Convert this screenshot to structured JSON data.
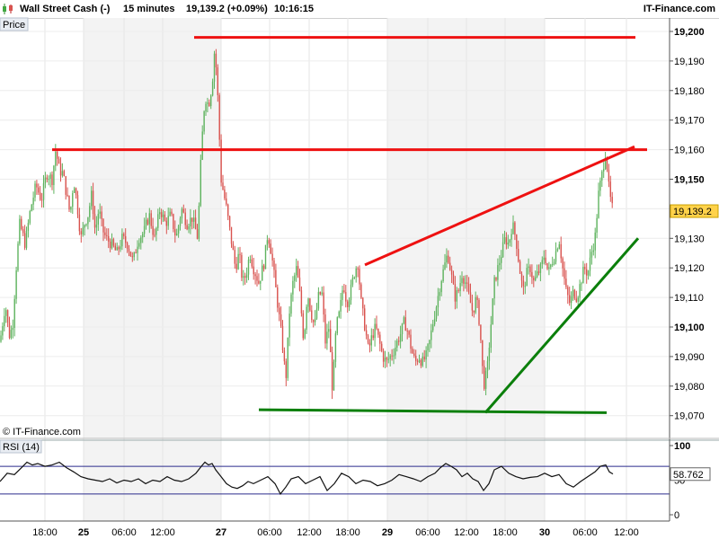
{
  "header": {
    "instrument": "Wall Street Cash (-)",
    "timeframe": "15 minutes",
    "last_price": "19,139.2 (+0.09%)",
    "time": "10:16:15",
    "brand": "IT-Finance.com",
    "chart_icon": "candlestick-icon"
  },
  "panels": {
    "price_label": "Price",
    "copyright": "© IT-Finance.com",
    "rsi_label": "RSI (14)"
  },
  "colors": {
    "bull": "#5fb35f",
    "bear": "#d9534f",
    "resistance": "#ee1111",
    "support": "#0b7f0b",
    "session_shade": "#f3f3f3",
    "rsi_band": "#2b2b8c"
  },
  "chart_data": [
    {
      "type": "candlestick",
      "title": "Wall Street Cash (-)",
      "ylim": [
        19065,
        19205
      ],
      "yticks": [
        19070,
        19080,
        19090,
        19100,
        19110,
        19120,
        19130,
        19140,
        19150,
        19160,
        19170,
        19180,
        19190,
        19200
      ],
      "ytick_labels": [
        "19,070",
        "19,080",
        "19,090",
        "19,100",
        "19,110",
        "19,120",
        "19,130",
        "",
        "19,150",
        "19,160",
        "19,170",
        "19,180",
        "19,190",
        "19,200"
      ],
      "bold_ticks": [
        19100,
        19150,
        19200
      ],
      "last_value": "19,139.2",
      "x_labels": [
        "18:00",
        "25",
        "06:00",
        "12:00",
        "27",
        "06:00",
        "12:00",
        "18:00",
        "29",
        "06:00",
        "12:00",
        "18:00",
        "30",
        "06:00",
        "12:00"
      ],
      "bold_x_labels": [
        "25",
        "27",
        "29",
        "30"
      ],
      "close_path": [
        [
          0,
          19095
        ],
        [
          6,
          19108
        ],
        [
          10,
          19097
        ],
        [
          14,
          19100
        ],
        [
          18,
          19120
        ],
        [
          22,
          19135
        ],
        [
          28,
          19128
        ],
        [
          34,
          19140
        ],
        [
          40,
          19148
        ],
        [
          46,
          19143
        ],
        [
          52,
          19152
        ],
        [
          58,
          19150
        ],
        [
          62,
          19160
        ],
        [
          66,
          19153
        ],
        [
          70,
          19152
        ],
        [
          74,
          19145
        ],
        [
          78,
          19138
        ],
        [
          82,
          19150
        ],
        [
          86,
          19141
        ],
        [
          90,
          19130
        ],
        [
          94,
          19135
        ],
        [
          98,
          19138
        ],
        [
          102,
          19145
        ],
        [
          106,
          19132
        ],
        [
          110,
          19140
        ],
        [
          114,
          19133
        ],
        [
          118,
          19130
        ],
        [
          124,
          19128
        ],
        [
          130,
          19125
        ],
        [
          136,
          19130
        ],
        [
          142,
          19128
        ],
        [
          148,
          19122
        ],
        [
          154,
          19130
        ],
        [
          160,
          19132
        ],
        [
          166,
          19138
        ],
        [
          172,
          19130
        ],
        [
          178,
          19140
        ],
        [
          184,
          19135
        ],
        [
          190,
          19138
        ],
        [
          196,
          19130
        ],
        [
          202,
          19140
        ],
        [
          208,
          19135
        ],
        [
          214,
          19137
        ],
        [
          220,
          19130
        ],
        [
          224,
          19160
        ],
        [
          228,
          19178
        ],
        [
          232,
          19175
        ],
        [
          236,
          19182
        ],
        [
          239,
          19195
        ],
        [
          242,
          19180
        ],
        [
          246,
          19150
        ],
        [
          252,
          19140
        ],
        [
          258,
          19128
        ],
        [
          262,
          19120
        ],
        [
          266,
          19125
        ],
        [
          270,
          19115
        ],
        [
          274,
          19118
        ],
        [
          278,
          19125
        ],
        [
          282,
          19120
        ],
        [
          288,
          19115
        ],
        [
          294,
          19122
        ],
        [
          298,
          19132
        ],
        [
          302,
          19125
        ],
        [
          306,
          19115
        ],
        [
          310,
          19105
        ],
        [
          314,
          19095
        ],
        [
          318,
          19082
        ],
        [
          322,
          19105
        ],
        [
          326,
          19115
        ],
        [
          330,
          19120
        ],
        [
          334,
          19110
        ],
        [
          338,
          19095
        ],
        [
          342,
          19112
        ],
        [
          346,
          19105
        ],
        [
          350,
          19100
        ],
        [
          354,
          19110
        ],
        [
          358,
          19112
        ],
        [
          362,
          19095
        ],
        [
          366,
          19100
        ],
        [
          370,
          19078
        ],
        [
          374,
          19100
        ],
        [
          378,
          19105
        ],
        [
          382,
          19115
        ],
        [
          386,
          19108
        ],
        [
          390,
          19112
        ],
        [
          394,
          19118
        ],
        [
          398,
          19122
        ],
        [
          402,
          19108
        ],
        [
          406,
          19100
        ],
        [
          410,
          19092
        ],
        [
          414,
          19097
        ],
        [
          418,
          19100
        ],
        [
          422,
          19095
        ],
        [
          426,
          19090
        ],
        [
          430,
          19088
        ],
        [
          434,
          19090
        ],
        [
          438,
          19092
        ],
        [
          442,
          19095
        ],
        [
          446,
          19098
        ],
        [
          450,
          19102
        ],
        [
          454,
          19098
        ],
        [
          458,
          19092
        ],
        [
          462,
          19088
        ],
        [
          466,
          19090
        ],
        [
          470,
          19088
        ],
        [
          474,
          19090
        ],
        [
          478,
          19095
        ],
        [
          482,
          19102
        ],
        [
          486,
          19108
        ],
        [
          490,
          19115
        ],
        [
          494,
          19120
        ],
        [
          498,
          19125
        ],
        [
          502,
          19118
        ],
        [
          506,
          19110
        ],
        [
          510,
          19112
        ],
        [
          514,
          19118
        ],
        [
          518,
          19115
        ],
        [
          522,
          19110
        ],
        [
          526,
          19105
        ],
        [
          530,
          19110
        ],
        [
          534,
          19100
        ],
        [
          538,
          19080
        ],
        [
          542,
          19085
        ],
        [
          546,
          19100
        ],
        [
          550,
          19115
        ],
        [
          554,
          19120
        ],
        [
          558,
          19125
        ],
        [
          562,
          19130
        ],
        [
          566,
          19128
        ],
        [
          570,
          19135
        ],
        [
          574,
          19130
        ],
        [
          578,
          19120
        ],
        [
          582,
          19112
        ],
        [
          586,
          19118
        ],
        [
          590,
          19120
        ],
        [
          594,
          19115
        ],
        [
          598,
          19118
        ],
        [
          602,
          19120
        ],
        [
          606,
          19125
        ],
        [
          610,
          19118
        ],
        [
          614,
          19122
        ],
        [
          618,
          19125
        ],
        [
          622,
          19130
        ],
        [
          626,
          19120
        ],
        [
          630,
          19112
        ],
        [
          634,
          19108
        ],
        [
          638,
          19112
        ],
        [
          642,
          19110
        ],
        [
          646,
          19115
        ],
        [
          650,
          19120
        ],
        [
          654,
          19118
        ],
        [
          658,
          19125
        ],
        [
          662,
          19130
        ],
        [
          666,
          19145
        ],
        [
          670,
          19152
        ],
        [
          674,
          19160
        ],
        [
          678,
          19145
        ],
        [
          682,
          19139
        ]
      ],
      "drawn_lines": [
        {
          "name": "resistance-top-line",
          "color": "resistance",
          "from": [
            216,
            19198
          ],
          "to": [
            707,
            19198
          ]
        },
        {
          "name": "resistance-mid-line",
          "color": "resistance",
          "from": [
            58,
            19160
          ],
          "to": [
            720,
            19160
          ]
        },
        {
          "name": "rising-resistance-line",
          "color": "resistance",
          "from": [
            406,
            19121
          ],
          "to": [
            706,
            19161
          ]
        },
        {
          "name": "support-base-line",
          "color": "support",
          "from": [
            288,
            19072
          ],
          "to": [
            675,
            19071
          ]
        },
        {
          "name": "rising-support-line",
          "color": "support",
          "from": [
            540,
            19071
          ],
          "to": [
            710,
            19130
          ]
        }
      ]
    },
    {
      "type": "line",
      "title": "RSI (14)",
      "ylim": [
        0,
        100
      ],
      "yticks": [
        0,
        50,
        100
      ],
      "ytick_labels": [
        "0",
        "50",
        "100"
      ],
      "bands": [
        30,
        70
      ],
      "last_value": "58.762",
      "x": [
        0,
        8,
        16,
        24,
        30,
        36,
        42,
        50,
        58,
        66,
        74,
        82,
        90,
        98,
        106,
        114,
        122,
        130,
        138,
        146,
        154,
        162,
        170,
        178,
        186,
        194,
        202,
        210,
        218,
        224,
        228,
        232,
        236,
        240,
        246,
        252,
        258,
        264,
        270,
        276,
        282,
        290,
        298,
        306,
        312,
        318,
        324,
        332,
        340,
        348,
        356,
        364,
        372,
        380,
        388,
        396,
        404,
        412,
        420,
        428,
        436,
        444,
        452,
        460,
        468,
        476,
        484,
        490,
        496,
        502,
        508,
        514,
        520,
        526,
        532,
        538,
        544,
        550,
        558,
        566,
        574,
        582,
        590,
        598,
        606,
        614,
        622,
        630,
        638,
        646,
        654,
        662,
        668,
        674,
        678,
        682
      ],
      "values": [
        48,
        60,
        58,
        68,
        76,
        72,
        74,
        70,
        72,
        76,
        68,
        62,
        55,
        52,
        50,
        48,
        52,
        46,
        50,
        48,
        52,
        45,
        50,
        48,
        55,
        50,
        48,
        52,
        60,
        70,
        76,
        72,
        74,
        65,
        55,
        45,
        40,
        38,
        42,
        48,
        45,
        50,
        55,
        45,
        30,
        40,
        52,
        55,
        45,
        50,
        55,
        35,
        45,
        60,
        55,
        45,
        50,
        48,
        42,
        45,
        50,
        58,
        55,
        52,
        48,
        55,
        60,
        68,
        74,
        70,
        65,
        55,
        60,
        52,
        48,
        35,
        45,
        65,
        70,
        60,
        55,
        52,
        54,
        55,
        60,
        55,
        58,
        45,
        40,
        48,
        55,
        62,
        70,
        72,
        62,
        59
      ]
    }
  ]
}
